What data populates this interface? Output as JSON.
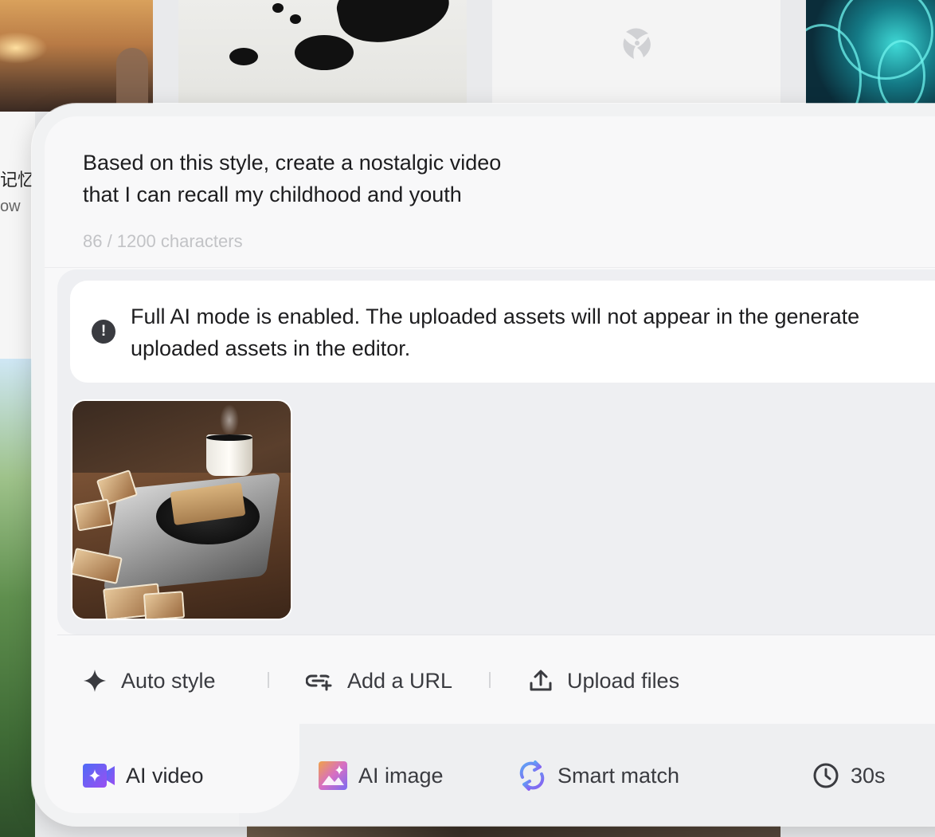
{
  "background": {
    "side_text_main": "记忆",
    "side_text_sub": "ow"
  },
  "composer": {
    "prompt_text": "Based on this style, create a nostalgic video that I can recall my childhood and youth",
    "prompt_line1": "Based on this style, create a nostalgic video",
    "prompt_line2": "that I can recall my childhood and youth",
    "char_count": "86 / 1200 characters",
    "notice_line1": "Full AI mode is enabled. The uploaded assets will not appear in the generate",
    "notice_line2": "uploaded assets in the editor.",
    "notice_icon": "!"
  },
  "toolbar": {
    "auto_style": "Auto style",
    "add_url": "Add a URL",
    "upload_files": "Upload files"
  },
  "modes": {
    "ai_video": "AI video",
    "ai_image": "AI image",
    "smart_match": "Smart match",
    "duration": "30s"
  },
  "colors": {
    "accent_video": "#6b5cf6",
    "accent_image": "#c86dd7",
    "accent_smart": "#5b7cf0",
    "text": "#1d1d1f",
    "muted": "#c2c3c6"
  },
  "icons": {
    "auto_style": "sparkle-icon",
    "add_url": "link-plus-icon",
    "upload_files": "upload-icon",
    "ai_video": "video-camera-icon",
    "ai_image": "image-icon",
    "smart_match": "refresh-icon",
    "duration": "clock-icon",
    "notice": "exclamation-icon"
  }
}
